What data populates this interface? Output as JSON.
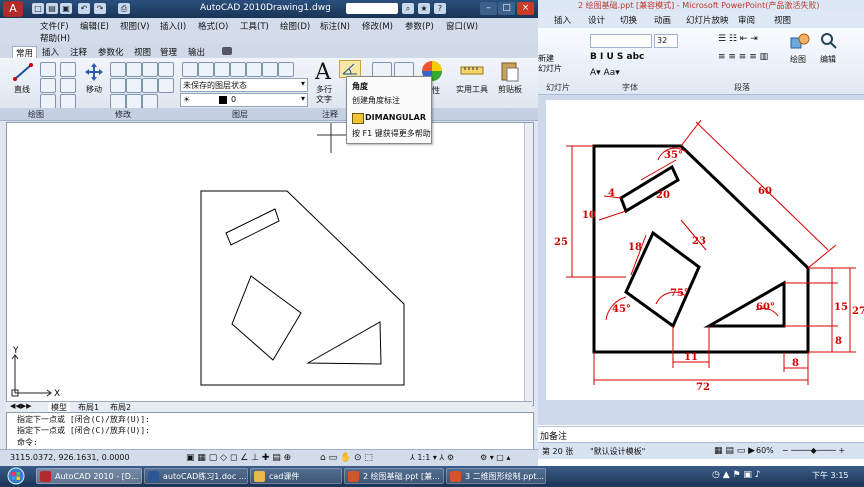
{
  "cad": {
    "app_title": "AutoCAD 2010",
    "doc_title": "Drawing1.dwg",
    "menu_row1": [
      "文件(F)",
      "编辑(E)",
      "视图(V)",
      "插入(I)",
      "格式(O)",
      "工具(T)",
      "绘图(D)",
      "标注(N)",
      "修改(M)",
      "参数(P)",
      "窗口(W)"
    ],
    "menu_help": "帮助(H)",
    "ribbon_tabs": [
      "常用",
      "插入",
      "注释",
      "参数化",
      "视图",
      "管理",
      "输出"
    ],
    "ribbon_labels": {
      "line": "直线",
      "move": "移动",
      "text": "多行\n文字",
      "utility": "实用工具",
      "clipboard": "剪贴板",
      "layer_state": "未保存的图层状态",
      "layer_num": "0",
      "props": "特性"
    },
    "panels": [
      "绘图",
      "修改",
      "图层",
      "注释"
    ],
    "tooltip": {
      "title": "角度",
      "desc": "创建角度标注",
      "command": "DIMANGULAR",
      "help": "按 F1 键获得更多帮助"
    },
    "layout_tabs": [
      "模型",
      "布局1",
      "布局2"
    ],
    "command_lines": [
      "指定下一点或 [闭合(C)/放弃(U)]:",
      "指定下一点或 [闭合(C)/放弃(U)]:",
      "命令:"
    ],
    "coords": "3115.0372, 926.1631, 0.0000",
    "axis_x": "X",
    "axis_y": "Y"
  },
  "ppt": {
    "title_text": "2 绘图基础.ppt [兼容模式] - Microsoft PowerPoint(产品激活失败)",
    "tabs": [
      "插入",
      "设计",
      "切换",
      "动画",
      "幻灯片放映",
      "审阅",
      "视图"
    ],
    "font_size": "32",
    "groups": [
      "幻灯片",
      "字体",
      "段落"
    ],
    "new_label": "新建\n幻灯片",
    "drawing_label": "绘图",
    "edit_label": "编辑",
    "notes_text": "加备注",
    "status_slide": "第 20 张",
    "status_theme": "\"默认设计模板\"",
    "zoom": "60%",
    "dims": {
      "d35": "35°",
      "d4": "4",
      "d20": "20",
      "d60": "60",
      "d10": "10",
      "d25": "25",
      "d18": "18",
      "d23": "23",
      "d45": "45°",
      "d75": "75°",
      "d60deg": "60°",
      "d15": "15",
      "d27": "27",
      "d8v": "8",
      "d11": "11",
      "d8h": "8",
      "d72": "72"
    }
  },
  "taskbar": {
    "items": [
      "AutoCAD 2010 - [D...",
      "autoCAD练习1.doc ...",
      "cad课件",
      "2 绘图基础.ppt [兼...",
      "3 二维图形绘制.ppt..."
    ],
    "clock": "下午 3:15"
  },
  "colors": {
    "dim_red": "#d40000",
    "cad_title": "#1f3b63"
  }
}
